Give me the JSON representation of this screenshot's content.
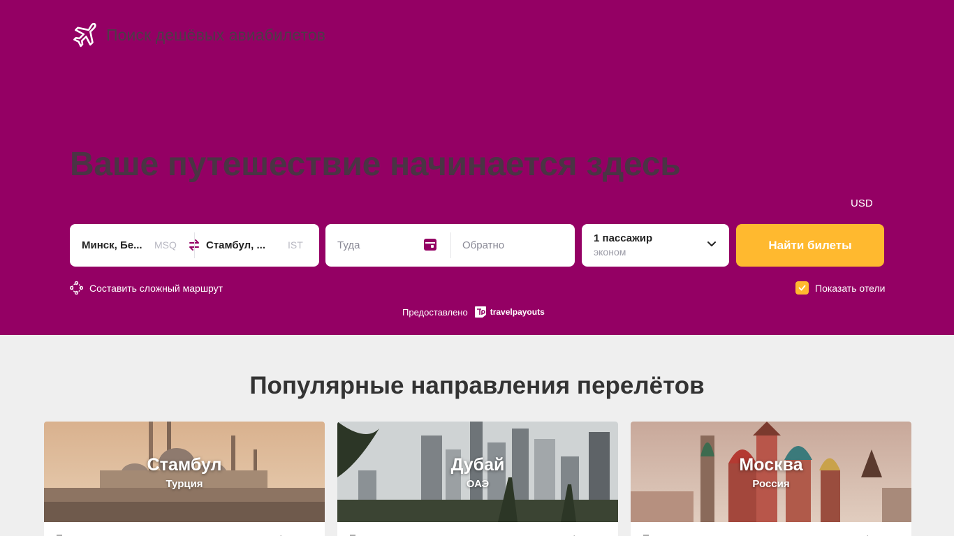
{
  "brand": {
    "name": "Поиск дешёвых авиабилетов",
    "icon": "airplane-icon"
  },
  "hero": {
    "headline": "Ваше путешествие начинается здесь",
    "currency": "USD"
  },
  "search": {
    "origin_city": "Минск, Бе...",
    "origin_iata": "MSQ",
    "destination_city": "Стамбул, ...",
    "destination_iata": "IST",
    "depart_placeholder": "Туда",
    "return_placeholder": "Обратно",
    "passengers": "1 пассажир",
    "cabin_class": "эконом",
    "submit_label": "Найти билеты"
  },
  "options": {
    "complex_route_label": "Составить сложный маршрут",
    "show_hotels_label": "Показать отели",
    "show_hotels_checked": true
  },
  "provider": {
    "prefix": "Предоставлено",
    "name": "travelpayouts"
  },
  "popular": {
    "title": "Популярные направления перелётов",
    "cards": [
      {
        "city": "Стамбул",
        "country": "Турция"
      },
      {
        "city": "Дубай",
        "country": "ОАЭ"
      },
      {
        "city": "Москва",
        "country": "Россия"
      }
    ]
  },
  "colors": {
    "hero_bg": "#940064",
    "accent": "#ffb92f",
    "page_bg": "#efefef"
  }
}
